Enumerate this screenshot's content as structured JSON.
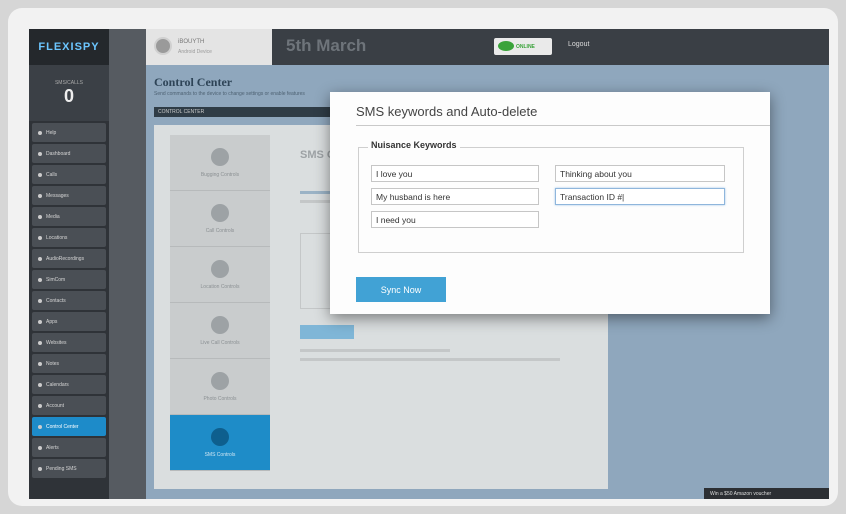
{
  "app": {
    "logo": "FLEXISPY"
  },
  "sidebar": {
    "counter_label": "SMS/CALLS",
    "counter_value": "0",
    "items": [
      {
        "label": "Help"
      },
      {
        "label": "Dashboard"
      },
      {
        "label": "Calls"
      },
      {
        "label": "Messages"
      },
      {
        "label": "Media"
      },
      {
        "label": "Locations"
      },
      {
        "label": "AudioRecordings"
      },
      {
        "label": "SimCom"
      },
      {
        "label": "Contacts"
      },
      {
        "label": "Apps"
      },
      {
        "label": "Websites"
      },
      {
        "label": "Notes"
      },
      {
        "label": "Calendars"
      },
      {
        "label": "Account"
      },
      {
        "label": "Control Center",
        "active": true
      },
      {
        "label": "Alerts"
      },
      {
        "label": "Pending SMS"
      }
    ]
  },
  "topbar": {
    "user_name": "iBOUYTH",
    "user_meta": "Android Device",
    "date": "5th March",
    "status": "ONLINE",
    "logout": "Logout"
  },
  "control_center": {
    "title": "Control Center",
    "subtitle": "Send commands to the device to change settings or enable features",
    "strip_label": "CONTROL CENTER",
    "tabs": [
      {
        "label": "Bugging Controls"
      },
      {
        "label": "Call Controls"
      },
      {
        "label": "Location Controls"
      },
      {
        "label": "Live Call Controls"
      },
      {
        "label": "Photo Controls"
      },
      {
        "label": "SMS Controls",
        "active": true
      }
    ],
    "body_heading": "SMS Co"
  },
  "modal": {
    "title": "SMS keywords and Auto-delete",
    "fieldset_legend": "Nuisance Keywords",
    "keywords": [
      {
        "value": "I love you"
      },
      {
        "value": "Thinking about you"
      },
      {
        "value": "My husband is here"
      },
      {
        "value": "Transaction ID #|"
      },
      {
        "value": "I need you"
      }
    ],
    "sync_button": "Sync Now"
  },
  "footer": {
    "promo": "Win a $50 Amazon voucher"
  }
}
